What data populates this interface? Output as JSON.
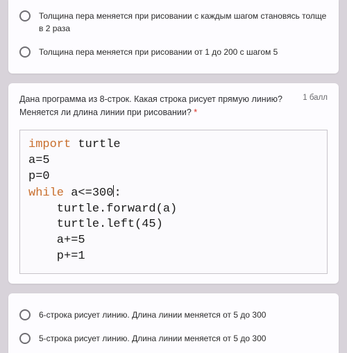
{
  "prev_question": {
    "options": [
      "Толщина пера меняется при рисовании с каждым шагом становясь толще в 2 раза",
      "Толщина пера меняется при рисовании от 1 до 200 с шагом 5"
    ]
  },
  "question": {
    "text_line1": "Дана программа из 8-строк. Какая строка рисует прямую линию?",
    "text_line2": "Меняется ли длина линии при рисовании?",
    "required_mark": "*",
    "points": "1 балл"
  },
  "code": {
    "kw_import": "import",
    "l1_rest": " turtle",
    "l2": "a=5",
    "l3": "p=0",
    "kw_while": "while",
    "l4_rest": " a<=300",
    "l4_after_cursor": ":",
    "l5": "    turtle.forward(a)",
    "l6": "    turtle.left(45)",
    "l7": "    a+=5",
    "l8": "    p+=1"
  },
  "answers": {
    "opt1": "6-строка рисует линию. Длина линии меняется от 5 до 300",
    "opt2": "5-строка рисует линию. Длина линии меняется от 5 до 300"
  }
}
